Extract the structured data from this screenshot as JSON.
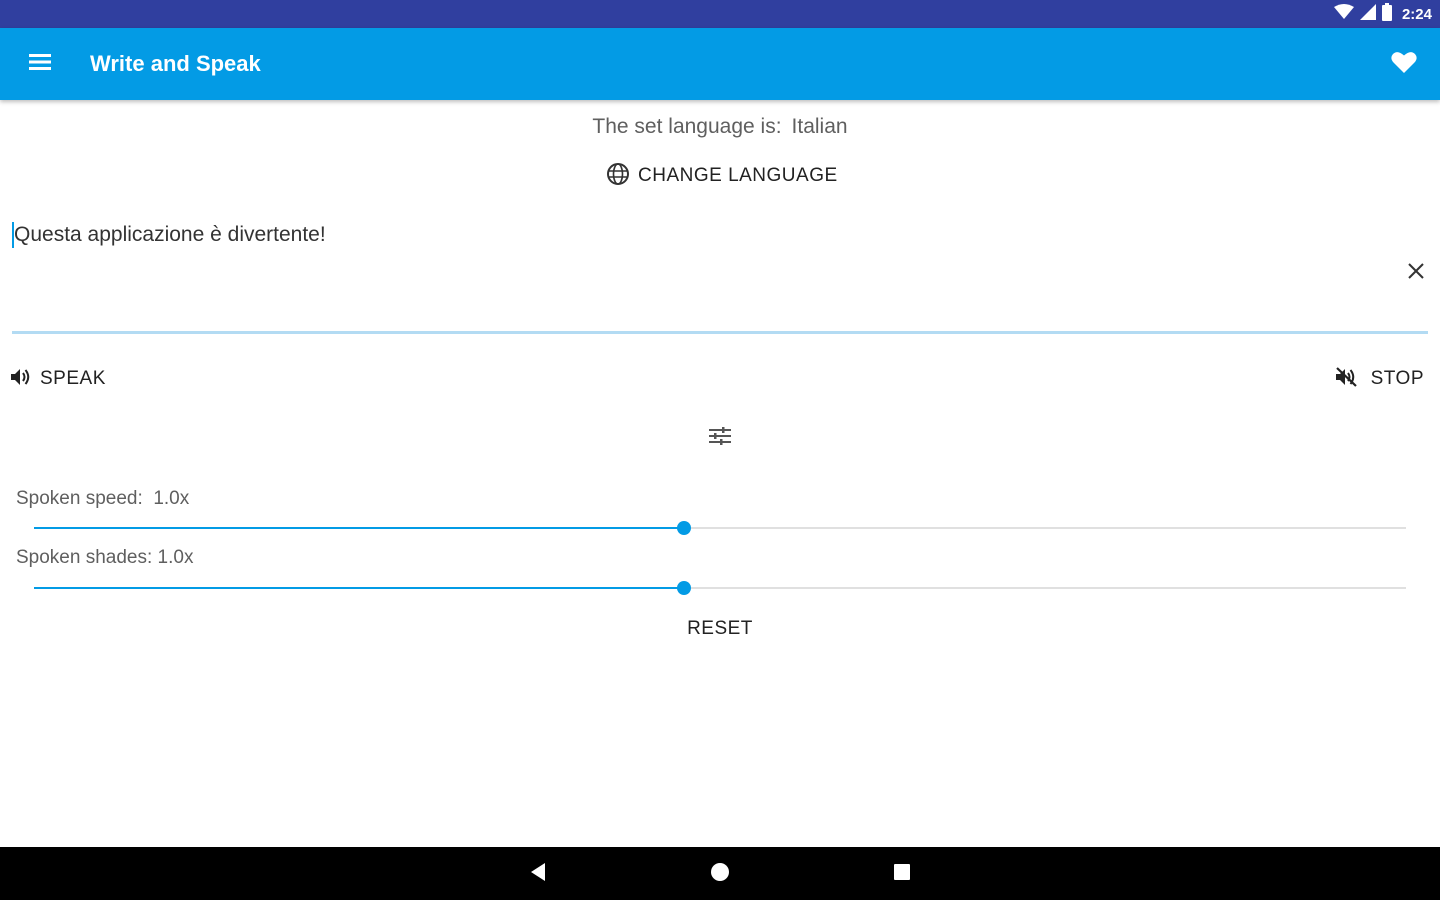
{
  "status_bar": {
    "time": "2:24"
  },
  "app_bar": {
    "title": "Write and Speak",
    "menu_icon": "hamburger-menu-icon",
    "favorite_icon": "heart-icon",
    "background_color": "#039be5"
  },
  "language": {
    "prefix": "The set language is:",
    "value": "Italian",
    "change_button_label": "CHANGE LANGUAGE",
    "change_button_icon": "globe-icon"
  },
  "text_input": {
    "value": "Questa applicazione è divertente!",
    "clear_icon": "close-icon"
  },
  "controls": {
    "speak_label": "SPEAK",
    "speak_icon": "volume-up-icon",
    "stop_label": "STOP",
    "stop_icon": "volume-off-icon",
    "tune_icon": "tune-icon"
  },
  "sliders": {
    "speed": {
      "label": "Spoken speed:",
      "value_text": "1.0x",
      "fraction": 0.4738
    },
    "shades": {
      "label": "Spoken shades:",
      "value_text": "1.0x",
      "fraction": 0.4738
    }
  },
  "reset_label": "RESET",
  "accent_color": "#039be5",
  "status_bar_color": "#303f9f"
}
